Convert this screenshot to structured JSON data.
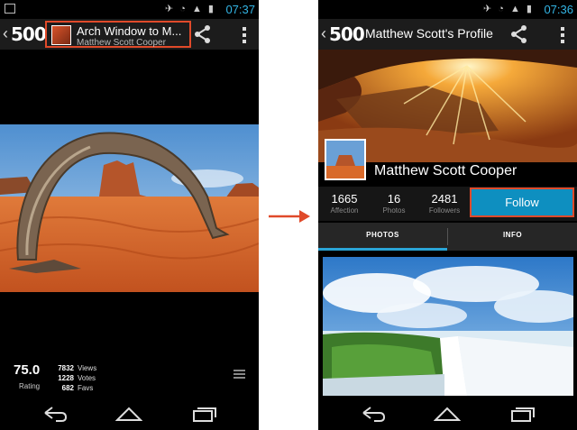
{
  "left_screen": {
    "status_time": "07:37",
    "logo": "500",
    "photo_title": "Arch Window to M...",
    "photo_author": "Matthew Scott Cooper",
    "rating_value": "75.0",
    "rating_label": "Rating",
    "metrics": [
      {
        "value": "7832",
        "label": "Views"
      },
      {
        "value": "1228",
        "label": "Votes"
      },
      {
        "value": "682",
        "label": "Favs"
      }
    ]
  },
  "right_screen": {
    "status_time": "07:36",
    "logo": "500",
    "title": "Matthew Scott's Profile",
    "profile_name": "Matthew Scott Cooper",
    "stats": [
      {
        "value": "1665",
        "label": "Affection"
      },
      {
        "value": "16",
        "label": "Photos"
      },
      {
        "value": "2481",
        "label": "Followers"
      }
    ],
    "follow_label": "Follow",
    "tabs": [
      "PHOTOS",
      "INFO"
    ]
  },
  "colors": {
    "highlight": "#e04a2a",
    "accent": "#0e8fc0",
    "status_accent": "#33b5e5"
  },
  "icons": [
    "back-icon",
    "share-icon",
    "overflow-menu-icon",
    "list-icon",
    "nav-back-icon",
    "nav-home-icon",
    "nav-recents-icon",
    "arrow-icon"
  ]
}
